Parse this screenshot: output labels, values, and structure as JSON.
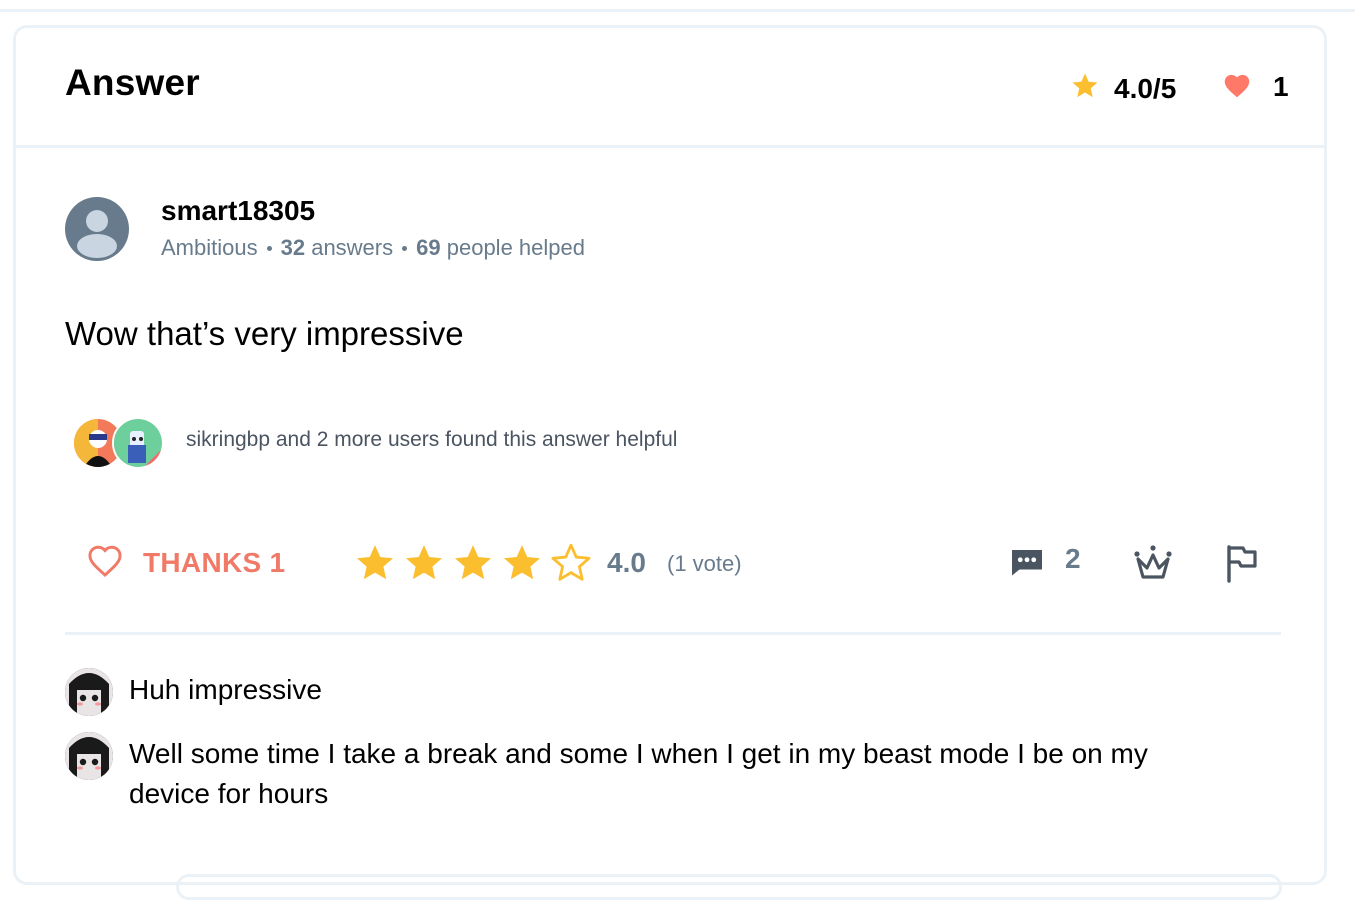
{
  "header": {
    "title": "Answer",
    "rating": "4.0/5",
    "likes": "1"
  },
  "author": {
    "username": "smart18305",
    "rank": "Ambitious",
    "answers_count": "32",
    "answers_label": "answers",
    "helped_count": "69",
    "helped_label": "people helped"
  },
  "answer": {
    "text": "Wow that’s very impressive"
  },
  "helpful": {
    "text": "sikringbp and 2 more users found this answer helpful"
  },
  "actions": {
    "thanks_label": "THANKS 1",
    "rating_value": "4.0",
    "votes_label": "(1 vote)",
    "star_rating": 4,
    "star_max": 5,
    "comments_count": "2"
  },
  "comments": [
    {
      "text": "Huh impressive"
    },
    {
      "text": "Well some time I take a break and some I when I get in my beast mode I be on my device for hours"
    }
  ],
  "colors": {
    "star": "#fbbe2e",
    "heart": "#ff7968",
    "thanks": "#f07a67",
    "muted": "#687b8c",
    "border": "#ebf2f7"
  },
  "icons": [
    "star-icon",
    "heart-icon",
    "avatar-icon",
    "comment-icon",
    "crown-icon",
    "flag-icon"
  ]
}
